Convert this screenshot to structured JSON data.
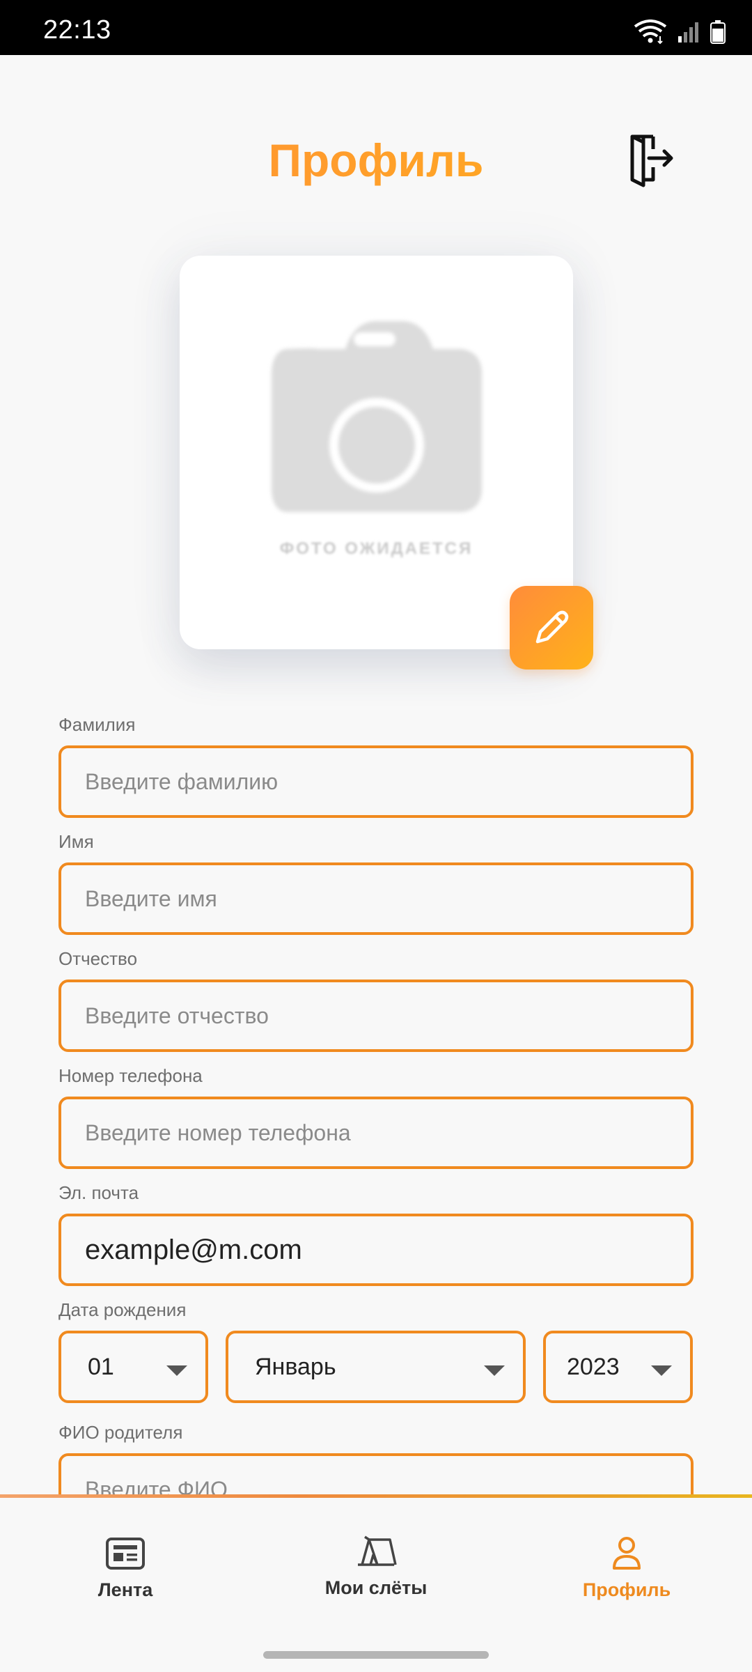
{
  "status_bar": {
    "time": "22:13"
  },
  "header": {
    "title": "Профиль"
  },
  "photo": {
    "placeholder_text": "ФОТО ОЖИДАЕТСЯ"
  },
  "form": {
    "last_name": {
      "label": "Фамилия",
      "placeholder": "Введите фамилию",
      "value": ""
    },
    "first_name": {
      "label": "Имя",
      "placeholder": "Введите имя",
      "value": ""
    },
    "middle_name": {
      "label": "Отчество",
      "placeholder": "Введите отчество",
      "value": ""
    },
    "phone": {
      "label": "Номер телефона",
      "placeholder": "Введите номер телефона",
      "value": ""
    },
    "email": {
      "label": "Эл. почта",
      "placeholder": "",
      "value": "example@m.com"
    },
    "birth_date": {
      "label": "Дата рождения",
      "day": "01",
      "month": "Январь",
      "year": "2023"
    },
    "parent_name": {
      "label": "ФИО родителя",
      "placeholder": "Введите ФИО",
      "value": ""
    }
  },
  "bottom_nav": {
    "items": [
      {
        "label": "Лента",
        "icon": "newspaper-icon",
        "active": false
      },
      {
        "label": "Мои слёты",
        "icon": "tent-icon",
        "active": false
      },
      {
        "label": "Профиль",
        "icon": "user-icon",
        "active": true
      }
    ]
  },
  "colors": {
    "accent": "#f08a1f",
    "accent_gradient_start": "#ff8c3a",
    "accent_gradient_end": "#ffb21a",
    "background": "#f8f8f8"
  }
}
